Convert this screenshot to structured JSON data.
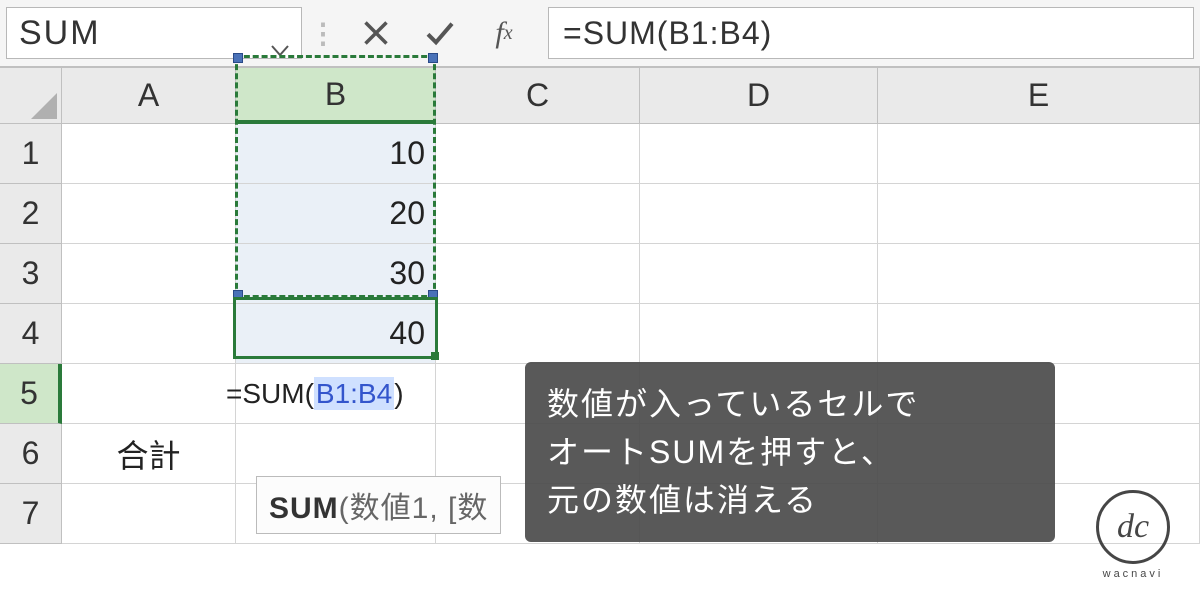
{
  "formula_bar": {
    "name_box": "SUM",
    "formula": "=SUM(B1:B4)"
  },
  "columns": [
    "A",
    "B",
    "C",
    "D",
    "E"
  ],
  "rows": [
    "1",
    "2",
    "3",
    "4",
    "5",
    "6",
    "7"
  ],
  "active_column": "B",
  "active_row": "5",
  "data": {
    "B1": "10",
    "B2": "20",
    "B3": "30",
    "B4": "40",
    "A6": "合計"
  },
  "active_cell_formula": {
    "prefix": "=SUM(",
    "ref": "B1:B4",
    "suffix": ")"
  },
  "tooltip": {
    "func": "SUM",
    "args": "(数値1, [数"
  },
  "annotation": {
    "line1": "数値が入っているセルで",
    "line2": "オートSUMを押すと、",
    "line3": "元の数値は消える"
  },
  "watermark": "wacnavi"
}
